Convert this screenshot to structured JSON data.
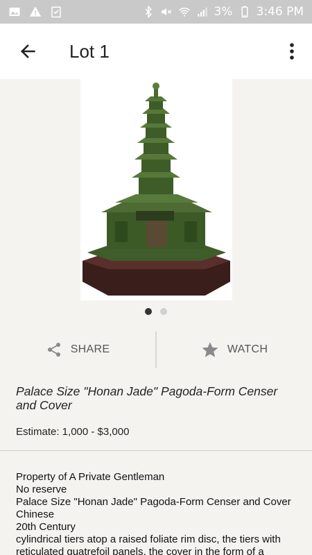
{
  "status_bar": {
    "battery": "3%",
    "time": "3:46 PM",
    "icons": [
      "image-icon",
      "warning-icon",
      "clipboard-check-icon",
      "bluetooth-icon",
      "mute-icon",
      "wifi-icon",
      "signal-icon",
      "battery-icon"
    ]
  },
  "app_bar": {
    "title": "Lot 1",
    "back_icon": "arrow-left-icon",
    "more_icon": "more-vertical-icon"
  },
  "gallery": {
    "image_description": "jade-pagoda-censer-photo",
    "pages": 2,
    "current_page": 1
  },
  "actions": {
    "share_label": "SHARE",
    "watch_label": "WATCH"
  },
  "lot": {
    "title": "Palace Size \"Honan Jade\" Pagoda-Form Censer and Cover",
    "estimate": "Estimate: 1,000 - $3,000",
    "description": [
      "Property of A Private Gentleman",
      "No reserve",
      "Palace Size \"Honan Jade\" Pagoda-Form Censer and Cover",
      "Chinese",
      "20th Century",
      "cylindrical tiers atop a raised foliate rim disc, the tiers with reticulated quatrefoil panels, the cover in the form of a"
    ]
  },
  "colors": {
    "background": "#f4f3f0",
    "status_bar": "#c9c9c9",
    "app_bar": "#ffffff",
    "icon_gray": "#8a8a8a"
  }
}
